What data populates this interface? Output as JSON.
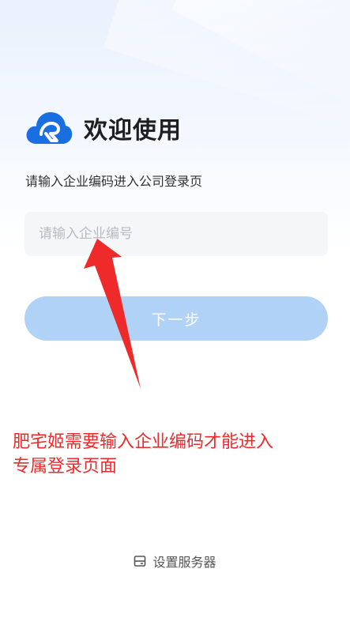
{
  "welcome_title": "欢迎使用",
  "subtitle": "请输入企业编码进入公司登录页",
  "company_input": {
    "value": "",
    "placeholder": "请输入企业编号"
  },
  "next_button_label": "下一步",
  "annotation": {
    "line1": "肥宅姬需要输入企业编码才能进入",
    "line2": "专属登录页面"
  },
  "server_settings_label": "设置服务器",
  "colors": {
    "brand_blue": "#1a6fe0",
    "button_disabled": "#b1d2f7",
    "annotation_red": "#ee2a2a"
  },
  "icons": {
    "logo": "cloud-logo-icon",
    "server": "server-icon"
  }
}
